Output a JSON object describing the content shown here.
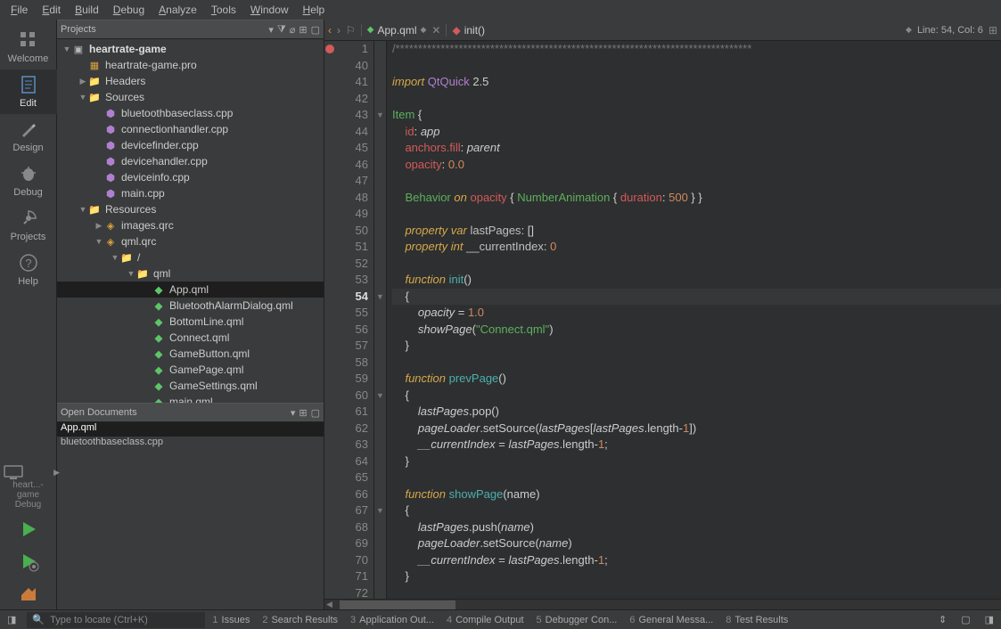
{
  "menu": [
    "File",
    "Edit",
    "Build",
    "Debug",
    "Analyze",
    "Tools",
    "Window",
    "Help"
  ],
  "sidebar": {
    "modes": [
      {
        "id": "welcome",
        "label": "Welcome"
      },
      {
        "id": "edit",
        "label": "Edit"
      },
      {
        "id": "design",
        "label": "Design"
      },
      {
        "id": "debug",
        "label": "Debug"
      },
      {
        "id": "projects",
        "label": "Projects"
      },
      {
        "id": "help",
        "label": "Help"
      }
    ],
    "activeMode": "edit",
    "kit": "heart...-game\nDebug"
  },
  "projectPanel": {
    "title": "Projects"
  },
  "tree": [
    {
      "d": 0,
      "a": "▼",
      "i": "proj",
      "t": "heartrate-game",
      "bold": true
    },
    {
      "d": 1,
      "a": "",
      "i": "pro",
      "t": "heartrate-game.pro"
    },
    {
      "d": 1,
      "a": "▶",
      "i": "folder",
      "t": "Headers"
    },
    {
      "d": 1,
      "a": "▼",
      "i": "folder",
      "t": "Sources"
    },
    {
      "d": 2,
      "a": "",
      "i": "cpp",
      "t": "bluetoothbaseclass.cpp"
    },
    {
      "d": 2,
      "a": "",
      "i": "cpp",
      "t": "connectionhandler.cpp"
    },
    {
      "d": 2,
      "a": "",
      "i": "cpp",
      "t": "devicefinder.cpp"
    },
    {
      "d": 2,
      "a": "",
      "i": "cpp",
      "t": "devicehandler.cpp"
    },
    {
      "d": 2,
      "a": "",
      "i": "cpp",
      "t": "deviceinfo.cpp"
    },
    {
      "d": 2,
      "a": "",
      "i": "cpp",
      "t": "main.cpp"
    },
    {
      "d": 1,
      "a": "▼",
      "i": "folder",
      "t": "Resources"
    },
    {
      "d": 2,
      "a": "▶",
      "i": "qrc",
      "t": "images.qrc"
    },
    {
      "d": 2,
      "a": "▼",
      "i": "qrc",
      "t": "qml.qrc"
    },
    {
      "d": 3,
      "a": "▼",
      "i": "folder",
      "t": "/"
    },
    {
      "d": 4,
      "a": "▼",
      "i": "folder",
      "t": "qml"
    },
    {
      "d": 5,
      "a": "",
      "i": "qml",
      "t": "App.qml",
      "sel": true
    },
    {
      "d": 5,
      "a": "",
      "i": "qml",
      "t": "BluetoothAlarmDialog.qml"
    },
    {
      "d": 5,
      "a": "",
      "i": "qml",
      "t": "BottomLine.qml"
    },
    {
      "d": 5,
      "a": "",
      "i": "qml",
      "t": "Connect.qml"
    },
    {
      "d": 5,
      "a": "",
      "i": "qml",
      "t": "GameButton.qml"
    },
    {
      "d": 5,
      "a": "",
      "i": "qml",
      "t": "GamePage.qml"
    },
    {
      "d": 5,
      "a": "",
      "i": "qml",
      "t": "GameSettings.qml"
    },
    {
      "d": 5,
      "a": "",
      "i": "qml",
      "t": "main.qml"
    }
  ],
  "openDocsPanel": {
    "title": "Open Documents"
  },
  "openDocs": [
    {
      "t": "App.qml",
      "sel": true
    },
    {
      "t": "bluetoothbaseclass.cpp"
    }
  ],
  "editor": {
    "file": "App.qml",
    "symbol": "init()",
    "pos": "Line: 54, Col: 6",
    "lines": [
      {
        "n": 1,
        "bm": true,
        "html": "<span class='c-cmt'>/*******************************************************************************</span>"
      },
      {
        "n": 40,
        "html": ""
      },
      {
        "n": 41,
        "html": "<span class='c-kw c-ital'>import</span> <span class='c-purple'>QtQuick</span> 2.5"
      },
      {
        "n": 42,
        "html": ""
      },
      {
        "n": 43,
        "fold": "▼",
        "html": "<span class='c-kw2'>Item</span> {"
      },
      {
        "n": 44,
        "html": "    <span class='c-red'>id</span>: <span class='c-ital'>app</span>"
      },
      {
        "n": 45,
        "html": "    <span class='c-red'>anchors.fill</span>: <span class='c-ital'>parent</span>"
      },
      {
        "n": 46,
        "html": "    <span class='c-red'>opacity</span>: <span class='c-num'>0.0</span>"
      },
      {
        "n": 47,
        "html": ""
      },
      {
        "n": 48,
        "html": "    <span class='c-kw2'>Behavior</span> <span class='c-kw c-ital'>on</span> <span class='c-red'>opacity</span> { <span class='c-kw2'>NumberAnimation</span> { <span class='c-red'>duration</span>: <span class='c-num'>500</span> } }"
      },
      {
        "n": 49,
        "html": ""
      },
      {
        "n": 50,
        "html": "    <span class='c-kw c-ital'>property</span> <span class='c-kw c-ital'>var</span> <span class='c-id'>lastPages</span>: []"
      },
      {
        "n": 51,
        "html": "    <span class='c-kw c-ital'>property</span> <span class='c-kw c-ital'>int</span> <span class='c-id'>__currentIndex</span>: <span class='c-num'>0</span>"
      },
      {
        "n": 52,
        "html": ""
      },
      {
        "n": 53,
        "html": "    <span class='c-kw c-ital'>function</span> <span class='c-prop'>init</span>()"
      },
      {
        "n": 54,
        "fold": "▼",
        "cur": true,
        "hl": true,
        "html": "    {"
      },
      {
        "n": 55,
        "html": "        <span class='c-ital'>opacity</span> = <span class='c-num'>1.0</span>"
      },
      {
        "n": 56,
        "html": "        <span class='c-ital'>showPage</span>(<span class='c-str'>\"Connect.qml\"</span>)"
      },
      {
        "n": 57,
        "html": "    }"
      },
      {
        "n": 58,
        "html": ""
      },
      {
        "n": 59,
        "html": "    <span class='c-kw c-ital'>function</span> <span class='c-prop'>prevPage</span>()"
      },
      {
        "n": 60,
        "fold": "▼",
        "html": "    {"
      },
      {
        "n": 61,
        "html": "        <span class='c-ital'>lastPages</span>.pop()"
      },
      {
        "n": 62,
        "html": "        <span class='c-ital'>pageLoader</span>.setSource(<span class='c-ital'>lastPages</span>[<span class='c-ital'>lastPages</span>.length-<span class='c-num'>1</span>])"
      },
      {
        "n": 63,
        "html": "        <span class='c-ital'>__currentIndex</span> = <span class='c-ital'>lastPages</span>.length-<span class='c-num'>1</span>;"
      },
      {
        "n": 64,
        "html": "    }"
      },
      {
        "n": 65,
        "html": ""
      },
      {
        "n": 66,
        "html": "    <span class='c-kw c-ital'>function</span> <span class='c-prop'>showPage</span>(name)"
      },
      {
        "n": 67,
        "fold": "▼",
        "html": "    {"
      },
      {
        "n": 68,
        "html": "        <span class='c-ital'>lastPages</span>.push(<span class='c-ital'>name</span>)"
      },
      {
        "n": 69,
        "html": "        <span class='c-ital'>pageLoader</span>.setSource(<span class='c-ital'>name</span>)"
      },
      {
        "n": 70,
        "html": "        <span class='c-ital'>__currentIndex</span> = <span class='c-ital'>lastPages</span>.length-<span class='c-num'>1</span>;"
      },
      {
        "n": 71,
        "html": "    }"
      },
      {
        "n": 72,
        "html": ""
      }
    ]
  },
  "locator": {
    "placeholder": "Type to locate (Ctrl+K)"
  },
  "outputs": [
    {
      "n": "1",
      "t": "Issues"
    },
    {
      "n": "2",
      "t": "Search Results"
    },
    {
      "n": "3",
      "t": "Application Out..."
    },
    {
      "n": "4",
      "t": "Compile Output"
    },
    {
      "n": "5",
      "t": "Debugger Con..."
    },
    {
      "n": "6",
      "t": "General Messa..."
    },
    {
      "n": "8",
      "t": "Test Results"
    }
  ]
}
